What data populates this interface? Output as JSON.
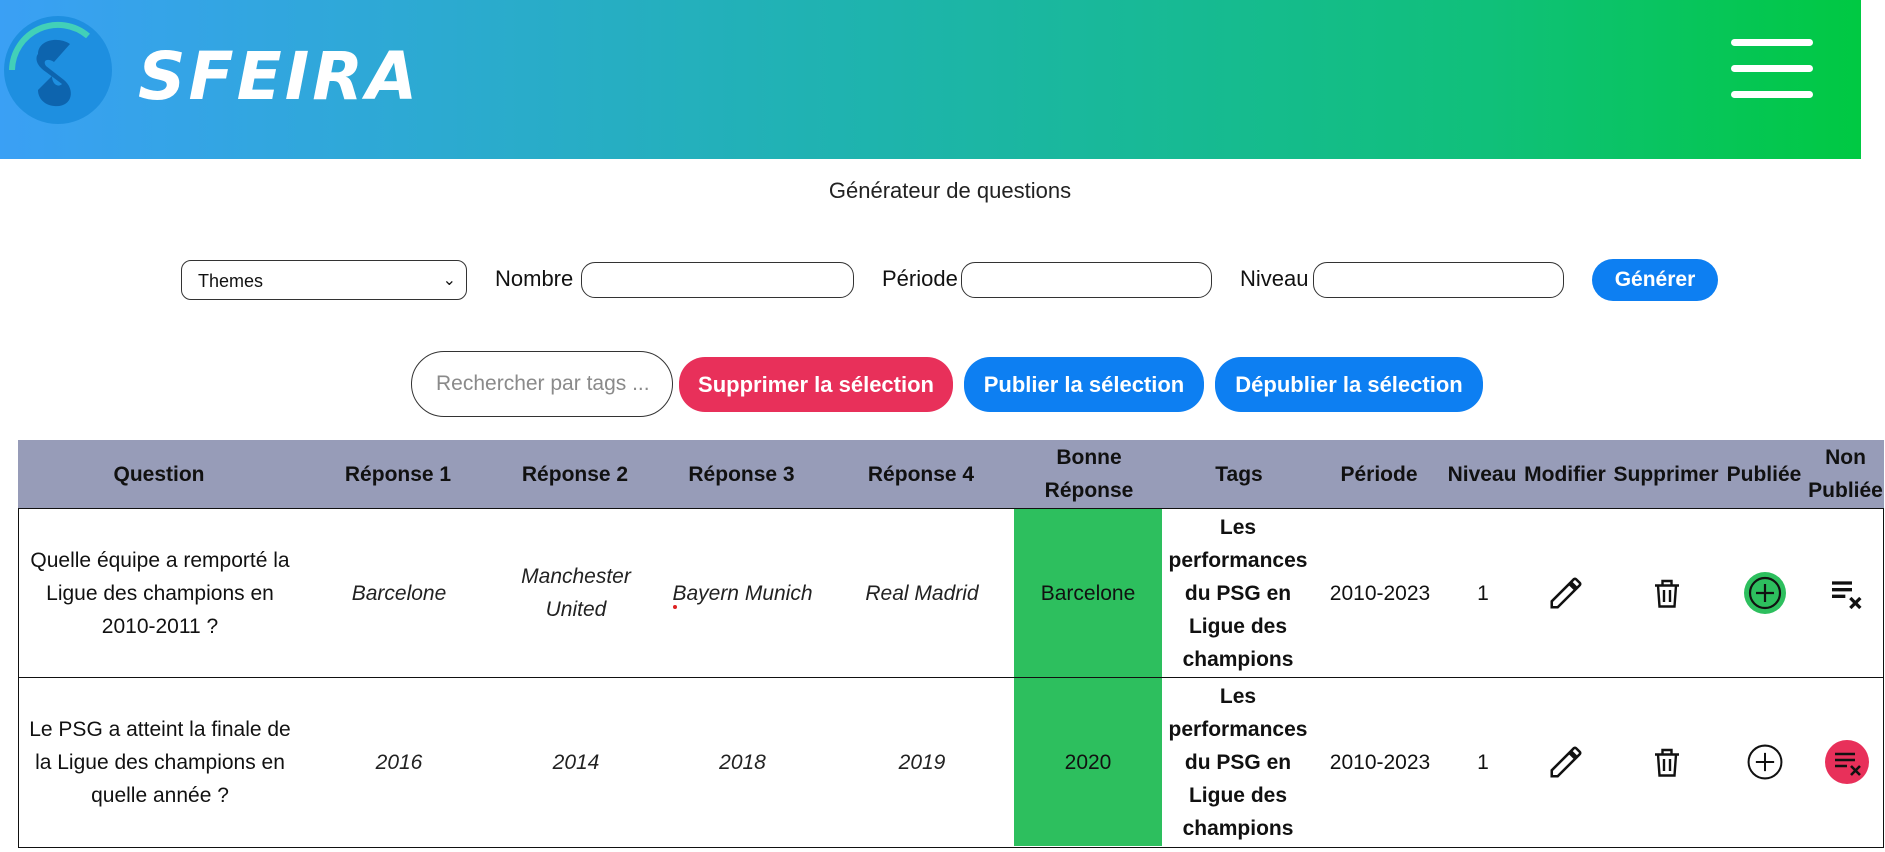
{
  "header": {
    "logo_text": "SFEIRA",
    "colors": {
      "gradient_start": "#3aa0f5",
      "gradient_end": "#00c942"
    }
  },
  "page_title": "Générateur de questions",
  "generator": {
    "themes_select": "Themes",
    "nombre_label": "Nombre",
    "nombre_value": "",
    "periode_label": "Période",
    "periode_value": "",
    "niveau_label": "Niveau",
    "niveau_value": "",
    "generate_button": "Générer"
  },
  "selection_bar": {
    "search_placeholder": "Rechercher par tags ...",
    "delete_button": "Supprimer la sélection",
    "publish_button": "Publier la sélection",
    "unpublish_button": "Dépublier la sélection"
  },
  "table": {
    "headers": {
      "question": "Question",
      "r1": "Réponse 1",
      "r2": "Réponse 2",
      "r3": "Réponse 3",
      "r4": "Réponse 4",
      "good": "Bonne Réponse",
      "tags": "Tags",
      "period": "Période",
      "level": "Niveau",
      "edit": "Modifier",
      "delete": "Supprimer",
      "published": "Publiée",
      "unpublished": "Non Publiée"
    },
    "rows": [
      {
        "question": "Quelle équipe a remporté la Ligue des champions en 2010-2011 ?",
        "r1": "Barcelone",
        "r2": "Manchester United",
        "r3": "Bayern Munich",
        "r4": "Real Madrid",
        "good": "Barcelone",
        "tags": "Les performances du PSG en Ligue des champions",
        "period": "2010-2023",
        "level": "1",
        "status": "published"
      },
      {
        "question": "Le PSG a atteint la finale de la Ligue des champions en quelle année ?",
        "r1": "2016",
        "r2": "2014",
        "r3": "2018",
        "r4": "2019",
        "good": "2020",
        "tags": "Les performances du PSG en Ligue des champions",
        "period": "2010-2023",
        "level": "1",
        "status": "unpublished"
      }
    ]
  },
  "icons": {
    "edit": "pencil-icon",
    "delete": "trash-icon",
    "publish": "plus-circle-icon",
    "unpublish": "playlist-remove-icon",
    "menu": "hamburger-menu-icon"
  },
  "colors": {
    "primary_blue": "#0d7ff2",
    "danger_red": "#e8305a",
    "good_answer_green": "#2dbf5e",
    "table_header": "#979cb8"
  }
}
